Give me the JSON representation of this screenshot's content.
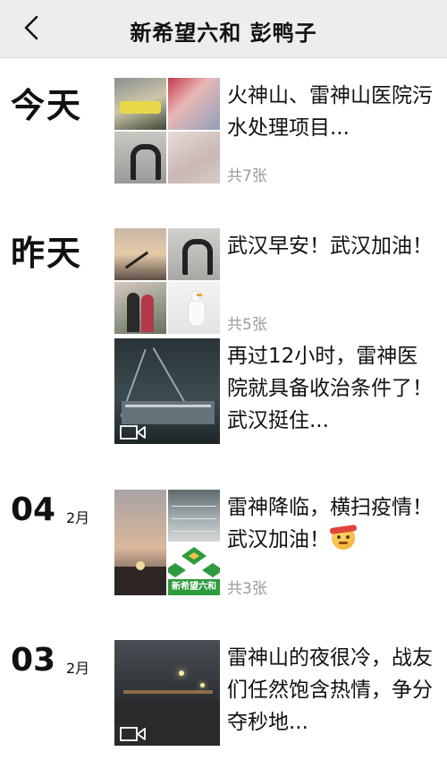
{
  "header": {
    "title": "新希望六和 彭鸭子"
  },
  "days": [
    {
      "label": "今天",
      "posts": [
        {
          "text": "火神山、雷神山医院污水处理项目...",
          "count": "共7张"
        }
      ]
    },
    {
      "label": "昨天",
      "posts": [
        {
          "text": "武汉早安！武汉加油！",
          "count": "共5张"
        },
        {
          "text": "再过12小时，雷神医院就具备收治条件了！武汉挺住...",
          "type": "video"
        }
      ]
    },
    {
      "day": "04",
      "month": "2月",
      "posts": [
        {
          "text": "雷神降临，横扫疫情！武汉加油！",
          "emoji": "angry-face-emoji",
          "count": "共3张",
          "logo_text": "新希望六和"
        }
      ]
    },
    {
      "day": "03",
      "month": "2月",
      "posts": [
        {
          "text": "雷神山的夜很冷，战友们任然饱含热情，争分夺秒地...",
          "type": "video"
        }
      ]
    }
  ],
  "colors": {
    "nav_background": "#ededed",
    "count_text": "#9a9a9a"
  }
}
